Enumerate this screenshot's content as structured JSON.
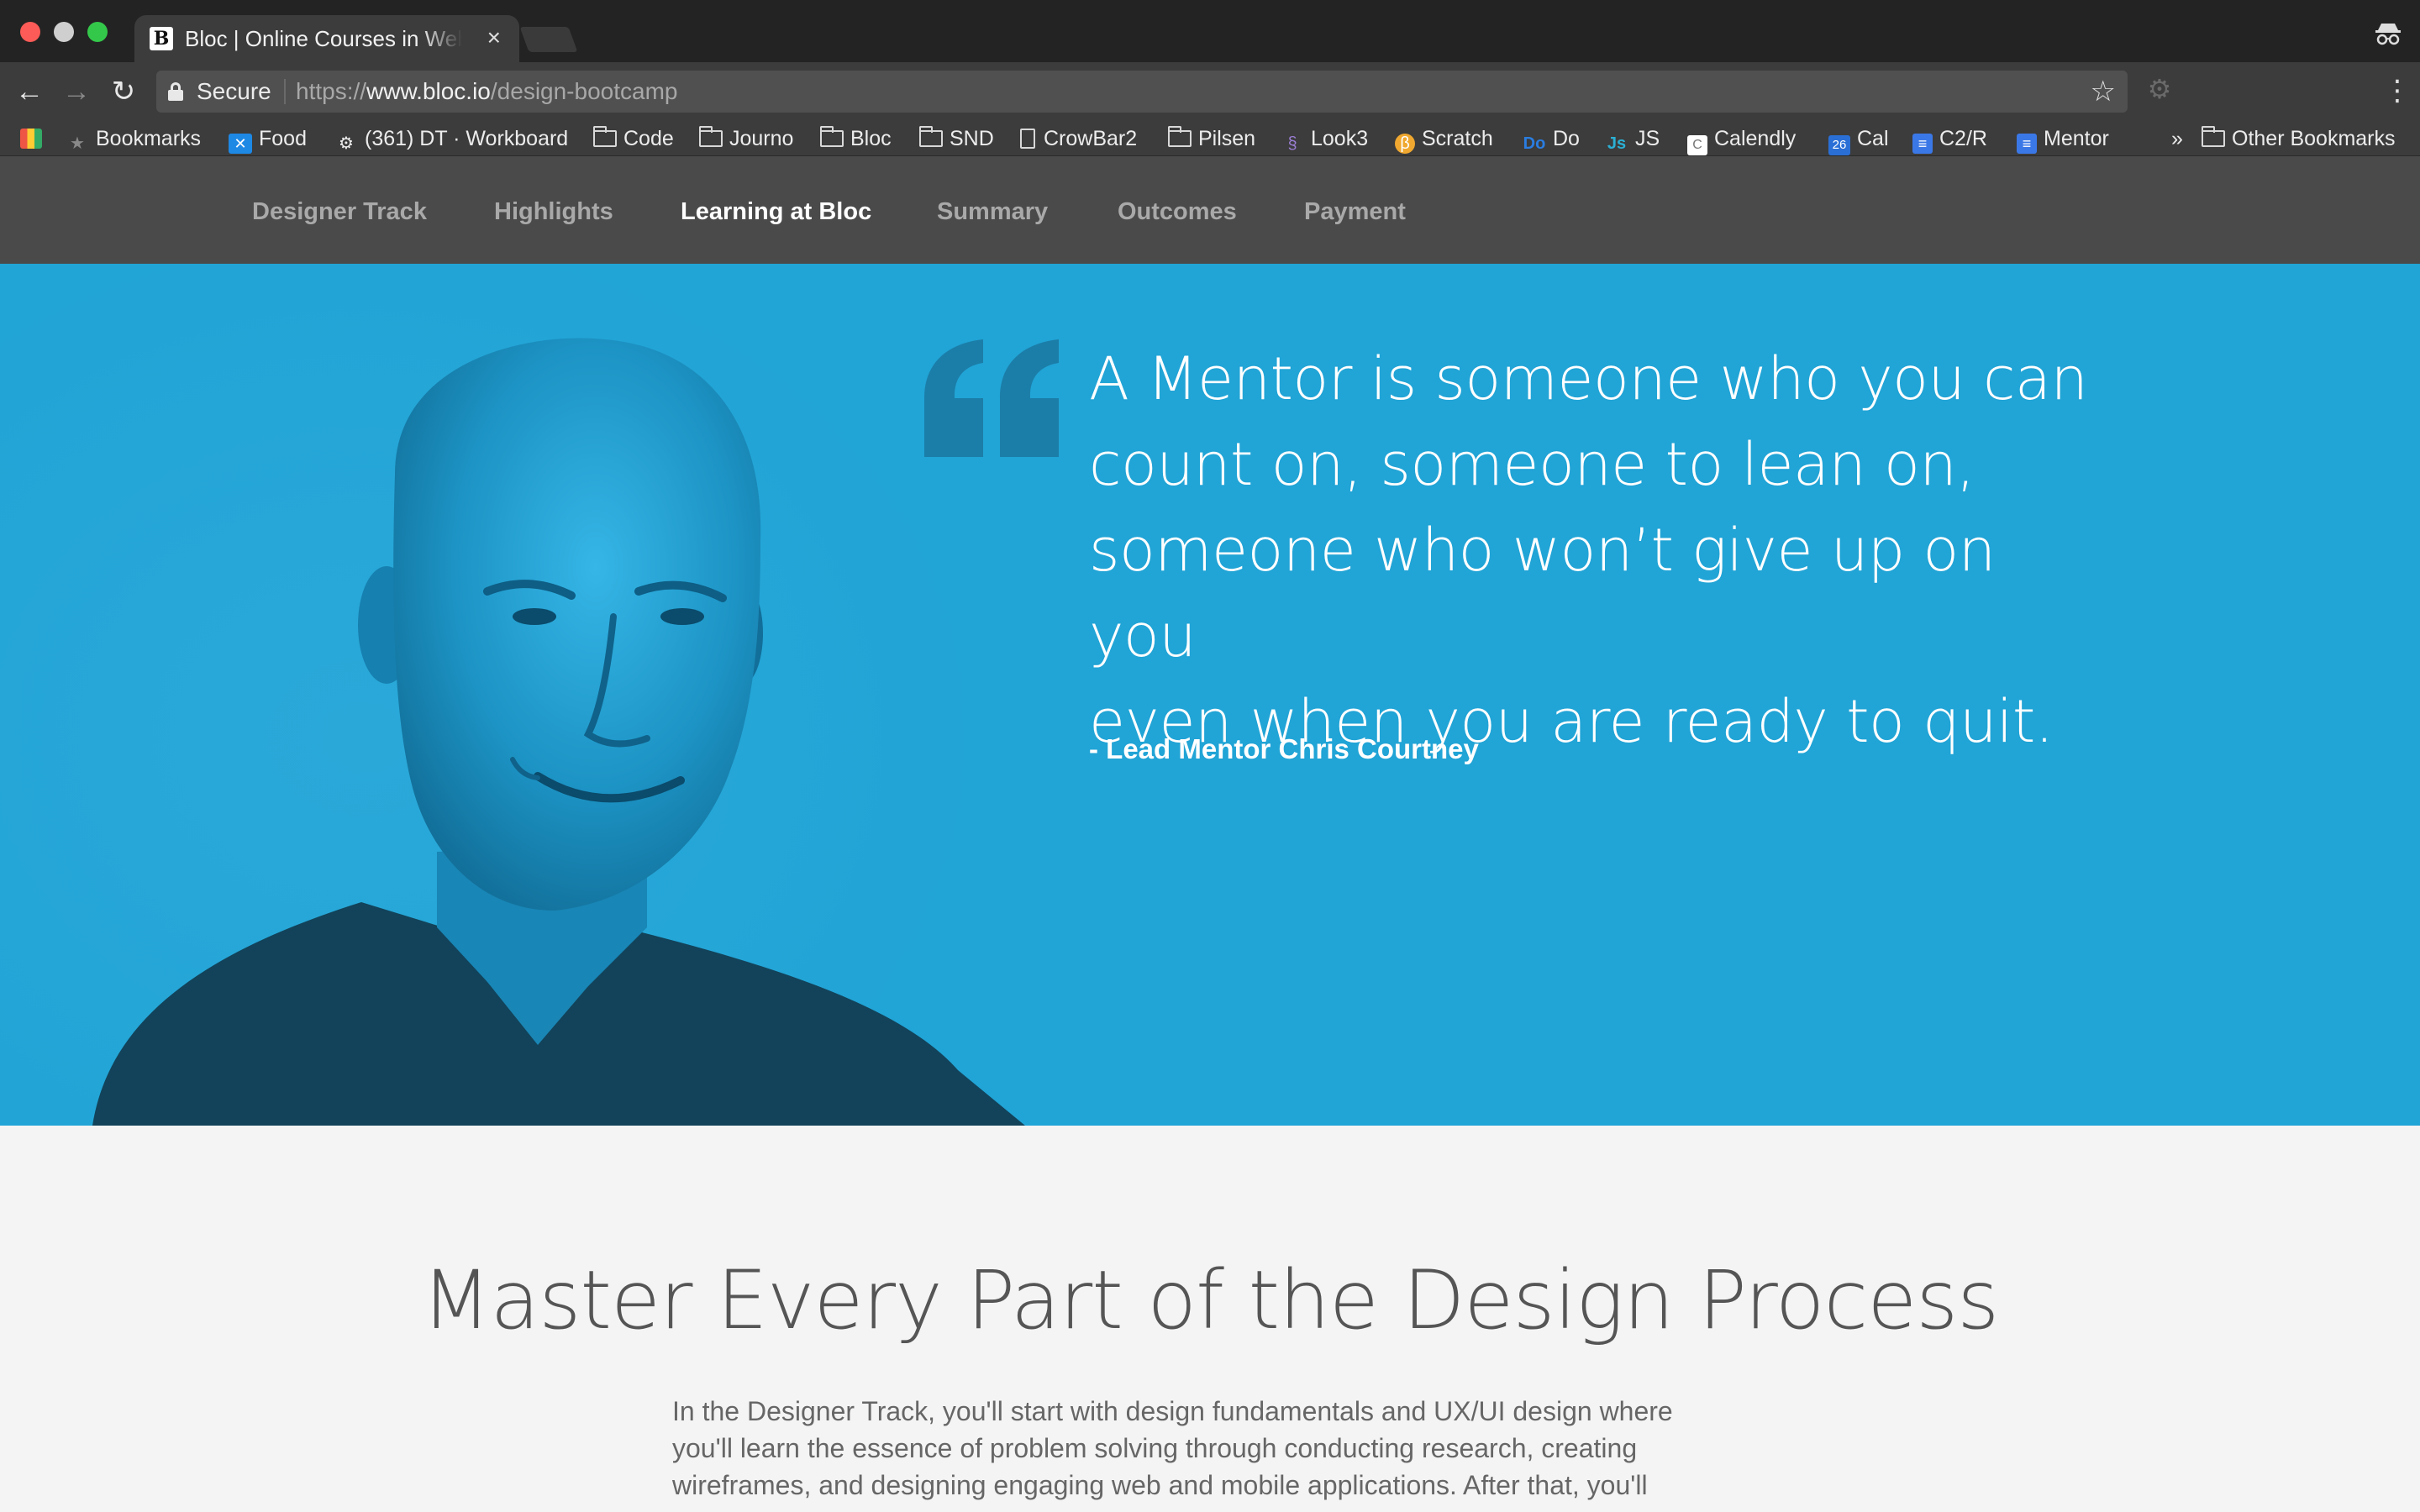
{
  "browser": {
    "tab_title": "Bloc | Online Courses in Web Development",
    "tab_favicon": "B",
    "secure_label": "Secure",
    "url_scheme": "https://",
    "url_host": "www.bloc.io",
    "url_path": "/design-bootcamp",
    "bookmarks": [
      {
        "label": "Bookmarks",
        "icon": "star-icon"
      },
      {
        "label": "Food",
        "icon": "app-icon"
      },
      {
        "label": "(361) DT · Workboard",
        "icon": "gear-icon"
      },
      {
        "label": "Code",
        "icon": "folder-icon"
      },
      {
        "label": "Journo",
        "icon": "folder-icon"
      },
      {
        "label": "Bloc",
        "icon": "folder-icon"
      },
      {
        "label": "SND",
        "icon": "folder-icon"
      },
      {
        "label": "CrowBar2",
        "icon": "document-icon"
      },
      {
        "label": "Pilsen",
        "icon": "folder-icon"
      },
      {
        "label": "Look3",
        "icon": "app-icon"
      },
      {
        "label": "Scratch",
        "icon": "app-icon"
      },
      {
        "label": "Do",
        "icon": "app-icon"
      },
      {
        "label": "JS",
        "icon": "app-icon"
      },
      {
        "label": "Calendly",
        "icon": "app-icon"
      },
      {
        "label": "Cal",
        "icon": "calendar-icon"
      },
      {
        "label": "C2/R",
        "icon": "docs-icon"
      },
      {
        "label": "Mentor",
        "icon": "docs-icon"
      }
    ],
    "overflow_label": "»",
    "other_bookmarks": "Other Bookmarks",
    "cal_day": "26"
  },
  "subnav": {
    "items": [
      {
        "label": "Designer Track"
      },
      {
        "label": "Highlights"
      },
      {
        "label": "Learning at Bloc"
      },
      {
        "label": "Summary"
      },
      {
        "label": "Outcomes"
      },
      {
        "label": "Payment"
      }
    ],
    "active_index": 2,
    "accent_color": "#ea5a2a"
  },
  "hero": {
    "background_color": "#21a4d6",
    "quote_lines": [
      "A Mentor is someone who you can",
      "count on, someone to lean on,",
      "someone who won’t give up on you",
      "even when you are ready to quit."
    ],
    "author": "- Lead Mentor Chris Courtney"
  },
  "section": {
    "title": "Master Every Part of the Design Process",
    "body_lines": [
      "In the Designer Track, you'll start with design fundamentals and UX/UI design where",
      "you'll learn the essence of problem solving through conducting research, creating",
      "wireframes, and designing engaging web and mobile applications. After that, you'll"
    ]
  }
}
